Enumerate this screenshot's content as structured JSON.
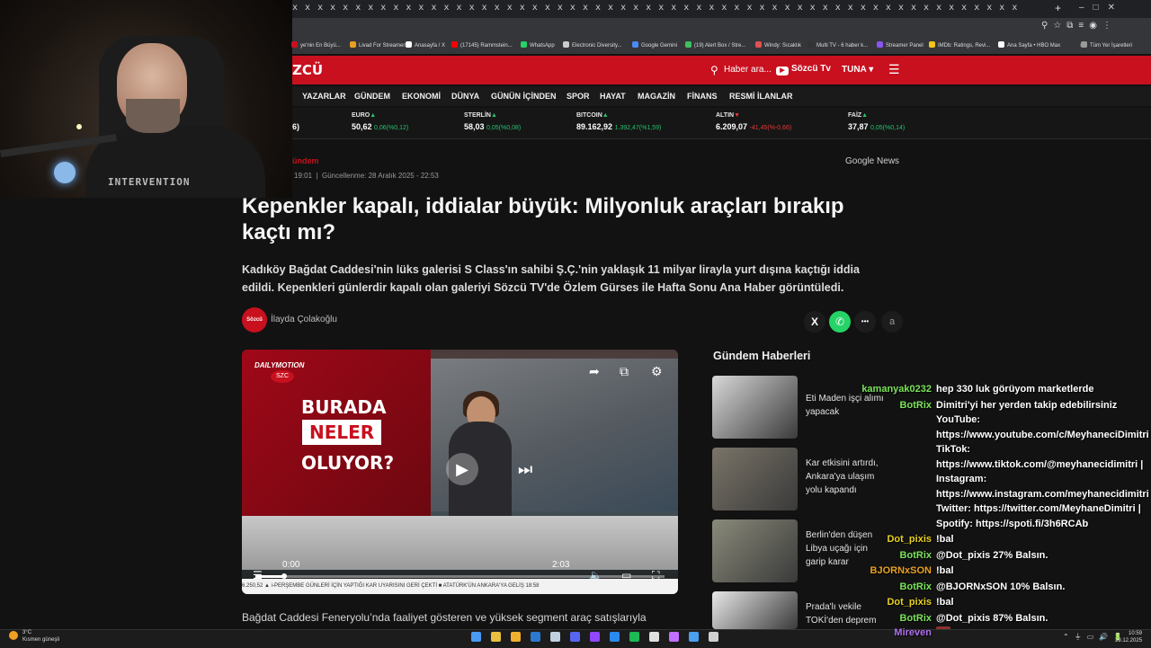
{
  "browser": {
    "tab_glyphs": "x x x x x x x x x x x x x x x x x x x x x x x x x x x x x x x x x x x x x x x x x x x x x x x x x x x x x x x x x x",
    "new_tab": "+",
    "bookmarks": [
      {
        "label": "ye'nin En Büyü...",
        "color": "#c8101e"
      },
      {
        "label": "Livad For Streamers",
        "color": "#e8a020"
      },
      {
        "label": "Anasayfa / X",
        "color": "#ffffff"
      },
      {
        "label": "(17145) Rammstein...",
        "color": "#ff0000"
      },
      {
        "label": "WhatsApp",
        "color": "#25d366"
      },
      {
        "label": "Electronic Diversity...",
        "color": "#cccccc"
      },
      {
        "label": "Google Gemini",
        "color": "#4a8af4"
      },
      {
        "label": "(19) Alert Box / Stre...",
        "color": "#3ec060"
      },
      {
        "label": "Windy: Sıcaklık",
        "color": "#e05050"
      },
      {
        "label": "Multi TV - 6 haber k...",
        "color": "#333333"
      },
      {
        "label": "Streamer Panel",
        "color": "#8855ee"
      },
      {
        "label": "IMDb: Ratings, Revi...",
        "color": "#f5c518"
      },
      {
        "label": "Ana Sayfa • HBO Max",
        "color": "#ffffff"
      },
      {
        "label": "»",
        "color": "#35363a"
      },
      {
        "label": "Tüm Yer İşaretleri",
        "color": "#999999"
      }
    ]
  },
  "site": {
    "logo": "ZCÜ",
    "search_placeholder": "Haber ara...",
    "tv_label": "Sözcü Tv",
    "user": "TUNA",
    "user_caret": "▾",
    "menu_icon": "☰",
    "nav": [
      "YAZARLAR",
      "GÜNDEM",
      "EKONOMİ",
      "DÜNYA",
      "GÜNÜN İÇİNDEN",
      "SPOR",
      "HAYAT",
      "MAGAZİN",
      "FİNANS",
      "RESMİ İLANLAR"
    ],
    "ticker": [
      {
        "name": "",
        "value": "6)",
        "change": ""
      },
      {
        "name": "EURO",
        "value": "50,62",
        "change": "0,06(%0,12)",
        "dir": "up"
      },
      {
        "name": "STERLİN",
        "value": "58,03",
        "change": "0,05(%0,08)",
        "dir": "up"
      },
      {
        "name": "BITCOIN",
        "value": "89.162,92",
        "change": "1.392,47(%1,59)",
        "dir": "up"
      },
      {
        "name": "ALTIN",
        "value": "6.209,07",
        "change": "-41,45(%-0,66)",
        "dir": "down"
      },
      {
        "name": "FAİZ",
        "value": "37,87",
        "change": "0,05(%0,14)",
        "dir": "up"
      }
    ]
  },
  "article": {
    "category": "ündem",
    "published": "19:01",
    "updated": "Güncellenme: 28 Aralık 2025 - 22:53",
    "google_news": [
      "Google",
      "News"
    ],
    "title": "Kepenkler kapalı, iddialar büyük: Milyonluk araçları bırakıp kaçtı mı?",
    "lead": "Kadıköy Bağdat Caddesi'nin lüks galerisi S Class'ın sahibi Ş.Ç.'nin yaklaşık 11 milyar lirayla yurt dışına kaçtığı iddia edildi. Kepenkleri günlerdir kapalı olan galeriyi Sözcü TV'de Özlem Gürses ile Hafta Sonu Ana Haber görüntüledi.",
    "author_logo": "Sözcü",
    "author": "İlayda Çolakoğlu",
    "share": {
      "x": "X",
      "whatsapp": "✆",
      "more": "•••",
      "font": "a"
    },
    "body_first_line": "Bağdat Caddesi Feneryolu’nda faaliyet gösteren ve yüksek segment araç satışlarıyla"
  },
  "video": {
    "brand": "DAILYMOTION",
    "channel": "SZC",
    "line1": "BURADA",
    "line2": "NELER",
    "line3": "OLUYOR?",
    "time_current": "0:00",
    "time_total": "2:03",
    "progress": 0.065,
    "crawl": "6.250,52 ▲  i-PERŞEMBE GÜNLERİ İÇİN YAPTIĞI KAR UYARISINI GERİ ÇEKTİ   ■   ATATÜRK'ÜN ANKARA'YA GELİŞ   18:58"
  },
  "sidebar": {
    "title": "Gündem Haberleri",
    "cards": [
      {
        "text": "Eti Maden işçi alımı yapacak",
        "color": "#d8d8d8"
      },
      {
        "text": "Kar etkisini artırdı, Ankara'ya ulaşım yolu kapandı",
        "color": "#7a7468"
      },
      {
        "text": "Berlin'den düşen Libya uçağı için garip karar",
        "color": "#8a8a7a"
      },
      {
        "text": "Prada'lı vekile TOKİ'den deprem",
        "color": "#e8e8e8"
      }
    ]
  },
  "webcam": {
    "shirt": "INTERVENTION"
  },
  "chat": [
    {
      "name": "kamanyak0232",
      "color": "#7be35a",
      "msg": "hep 330 luk görüyom marketlerde"
    },
    {
      "name": "BotRix",
      "color": "#7be35a",
      "msg": "Dimitri'yi her yerden takip edebilirsiniz"
    },
    {
      "name": "",
      "color": "#ffffff",
      "msg": "YouTube:"
    },
    {
      "name": "",
      "color": "#ffffff",
      "msg": "https://www.youtube.com/c/MeyhaneciDimitri |"
    },
    {
      "name": "",
      "color": "#ffffff",
      "msg": "TikTok:"
    },
    {
      "name": "",
      "color": "#ffffff",
      "msg": "https://www.tiktok.com/@meyhanecidimitri |"
    },
    {
      "name": "",
      "color": "#ffffff",
      "msg": "Instagram:"
    },
    {
      "name": "",
      "color": "#ffffff",
      "msg": "https://www.instagram.com/meyhanecidimitri |"
    },
    {
      "name": "",
      "color": "#ffffff",
      "msg": "Twitter: https://twitter.com/MeyhaneDimitri |"
    },
    {
      "name": "",
      "color": "#ffffff",
      "msg": "Spotify: https://spoti.fi/3h6RCAb"
    },
    {
      "name": "Dot_pixis",
      "color": "#e8d020",
      "msg": "!bal"
    },
    {
      "name": "BotRix",
      "color": "#7be35a",
      "msg": "@Dot_pixis 27% Balsın."
    },
    {
      "name": "BJORNxSON",
      "color": "#e8a020",
      "msg": "!bal"
    },
    {
      "name": "BotRix",
      "color": "#7be35a",
      "msg": "@BJORNxSON 10% Balsın."
    },
    {
      "name": "Dot_pixis",
      "color": "#e8d020",
      "msg": "!bal"
    },
    {
      "name": "BotRix",
      "color": "#7be35a",
      "msg": "@Dot_pixis 87% Balsın."
    },
    {
      "name": "Mireven",
      "color": "#b070f0",
      "msg": ""
    }
  ],
  "taskbar": {
    "temp": "3°C",
    "weather": "Kısmen güneşli",
    "time": "10:59",
    "date": "29.12.2025",
    "icons": [
      "#4a9af4",
      "#e8c040",
      "#f0b030",
      "#2b7ad0",
      "#c0d0e0",
      "#5865f2",
      "#9146ff",
      "#2a8af0",
      "#1db954",
      "#e0e0e0",
      "#c070ff",
      "#4aa0f0",
      "#d0d0d0"
    ]
  }
}
